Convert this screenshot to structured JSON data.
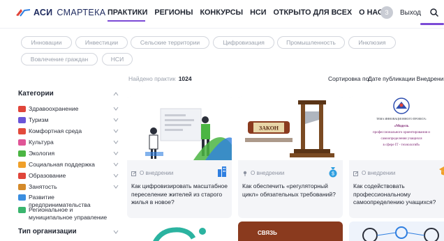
{
  "header": {
    "logo_bold": "АСИ",
    "logo_rest": "СМАРТЕКА",
    "nav": [
      "ПРАКТИКИ",
      "РЕГИОНЫ",
      "КОНКУРСЫ",
      "НСИ",
      "ОТКРЫТО ДЛЯ ВСЕХ",
      "О НАС"
    ],
    "avatar_letter": "З",
    "logout_label": "Выход",
    "colors": {
      "accent": "#7b4ad6",
      "brand": "#1e2a5e"
    }
  },
  "tags": [
    "Инновации",
    "Инвестиции",
    "Сельские территории",
    "Цифровизация",
    "Промышленность",
    "Инклюзия",
    "Вовлечение граждан",
    "НСИ"
  ],
  "results": {
    "found_label": "Найдено практик",
    "found_count": "1024",
    "sort_label": "Сортировка по:",
    "sort_value": "Дате публикации  Внедрени"
  },
  "sidebar": {
    "categories_title": "Категории",
    "categories": [
      {
        "label": "Здравоохранение",
        "icon": "health-icon",
        "color": "#e0453a"
      },
      {
        "label": "Туризм",
        "icon": "plane-icon",
        "color": "#6a55d8"
      },
      {
        "label": "Комфортная среда",
        "icon": "city-icon",
        "color": "#e24a3b"
      },
      {
        "label": "Культура",
        "icon": "culture-icon",
        "color": "#e05597"
      },
      {
        "label": "Экология",
        "icon": "leaf-icon",
        "color": "#4bb543"
      },
      {
        "label": "Социальная поддержка",
        "icon": "support-icon",
        "color": "#f0a02a"
      },
      {
        "label": "Образование",
        "icon": "education-icon",
        "color": "#e0453a"
      },
      {
        "label": "Занятость",
        "icon": "work-icon",
        "color": "#d48a2a"
      },
      {
        "label": "Развитие\nпредпринимательства",
        "icon": "business-icon",
        "color": "#3a8ee0"
      },
      {
        "label": "Региональное и\nмуниципальное управление",
        "icon": "government-icon",
        "color": "#3ab56e"
      }
    ],
    "org_title": "Тип организации"
  },
  "cards": [
    {
      "meta": "О внедрении",
      "title": "Как цифровизировать масштабное переселение жителей из старого жилья в новое?",
      "badge_icon": "city-icon",
      "badge_color": "#2f7fe0"
    },
    {
      "meta": "О внедрении",
      "title": "Как обеспечить «регуляторный цикл» обязательных требований?",
      "badge_icon": "money-bag-icon",
      "badge_color": "#2f9fe0"
    },
    {
      "meta": "О внедрении",
      "title": "Как содействовать профессиональному самоопределению учащихся?",
      "badge_icon": "education-icon",
      "badge_color": "#f0a02a"
    }
  ],
  "card3_image": {
    "line1": "ТЕМА ИННОВАЦИОННОГО ПРОЕКТА:",
    "line2": "«Модель",
    "line3": "профессионального ориентирования и",
    "line4": "самоопределения учащихся",
    "line5": "в сфере IT - технологий»"
  },
  "card2_image": {
    "sign_text": "ЗАКОН"
  },
  "bottom_cards": [
    {
      "label": ""
    },
    {
      "label": "СВЯЗЬ"
    },
    {
      "label": ""
    }
  ]
}
